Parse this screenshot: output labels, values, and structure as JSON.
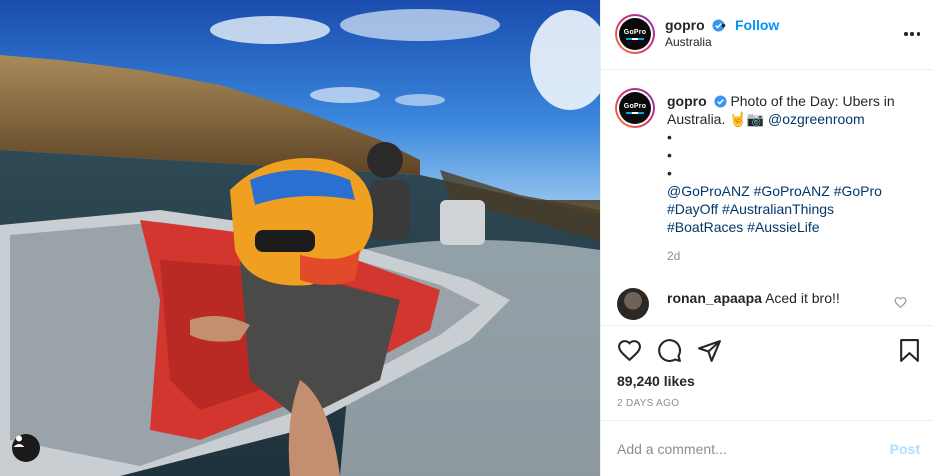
{
  "post": {
    "username": "gopro",
    "follow_dot": "•",
    "follow_label": "Follow",
    "location": "Australia",
    "avatar_logo_text": "GoPro"
  },
  "caption": {
    "username": "gopro",
    "text": "Photo of the Day: Ubers in Australia. 🤘📷",
    "mention": "@ozgreenroom",
    "bullets": [
      "•",
      "•",
      "•"
    ],
    "hashtags_line1": "@GoProANZ #GoProANZ #GoPro",
    "hashtags_line2": "#DayOff #AustralianThings",
    "hashtags_line3": "#BoatRaces #AussieLife",
    "time_ago": "2d"
  },
  "comment": {
    "username": "ronan_apaapa",
    "text": "Aced it bro!!"
  },
  "stats": {
    "likes": "89,240 likes",
    "date": "2 DAYS AGO"
  },
  "add_comment": {
    "placeholder": "Add a comment...",
    "post_label": "Post"
  },
  "icons": {
    "like": "heart-icon",
    "comment": "speech-bubble-icon",
    "share": "paper-plane-icon",
    "save": "bookmark-icon",
    "more": "more-options-icon",
    "tag": "user-tag-icon"
  },
  "colors": {
    "follow": "#0095f6",
    "post_disabled": "#b2dffc",
    "link": "#00376b",
    "muted": "#8e8e8e"
  }
}
